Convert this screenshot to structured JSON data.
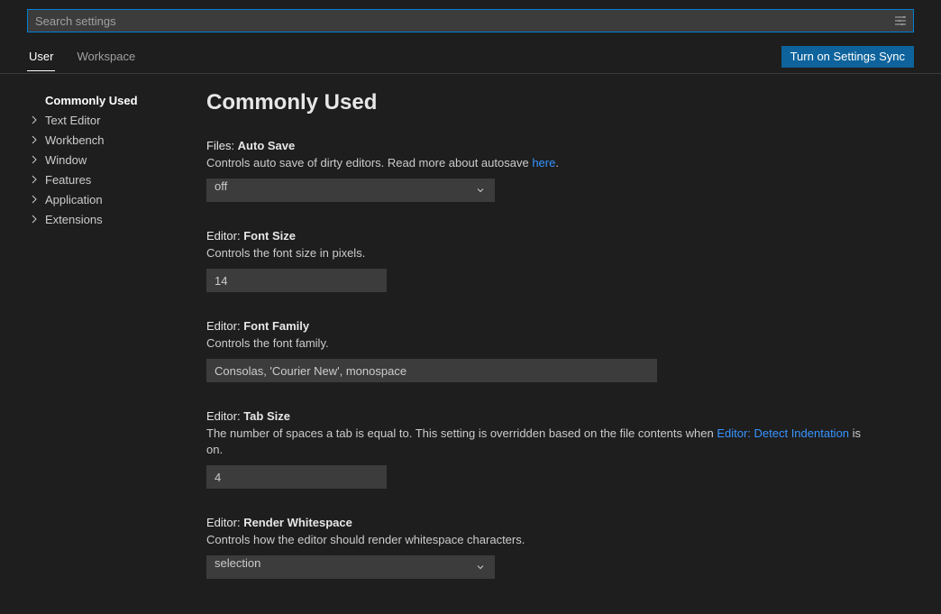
{
  "search": {
    "placeholder": "Search settings"
  },
  "tabs": {
    "user": "User",
    "workspace": "Workspace"
  },
  "syncButton": "Turn on Settings Sync",
  "sidebar": {
    "items": [
      {
        "label": "Commonly Used",
        "selected": true
      },
      {
        "label": "Text Editor"
      },
      {
        "label": "Workbench"
      },
      {
        "label": "Window"
      },
      {
        "label": "Features"
      },
      {
        "label": "Application"
      },
      {
        "label": "Extensions"
      }
    ]
  },
  "section": {
    "title": "Commonly Used"
  },
  "settings": {
    "autoSave": {
      "prefix": "Files: ",
      "name": "Auto Save",
      "descPre": "Controls auto save of dirty editors. Read more about autosave ",
      "descLink": "here",
      "descPost": ".",
      "value": "off"
    },
    "fontSize": {
      "prefix": "Editor: ",
      "name": "Font Size",
      "desc": "Controls the font size in pixels.",
      "value": "14"
    },
    "fontFamily": {
      "prefix": "Editor: ",
      "name": "Font Family",
      "desc": "Controls the font family.",
      "value": "Consolas, 'Courier New', monospace"
    },
    "tabSize": {
      "prefix": "Editor: ",
      "name": "Tab Size",
      "descPre": "The number of spaces a tab is equal to. This setting is overridden based on the file contents when ",
      "descLink": "Editor: Detect Indentation",
      "descPost": " is on.",
      "value": "4"
    },
    "renderWhitespace": {
      "prefix": "Editor: ",
      "name": "Render Whitespace",
      "desc": "Controls how the editor should render whitespace characters.",
      "value": "selection"
    }
  }
}
